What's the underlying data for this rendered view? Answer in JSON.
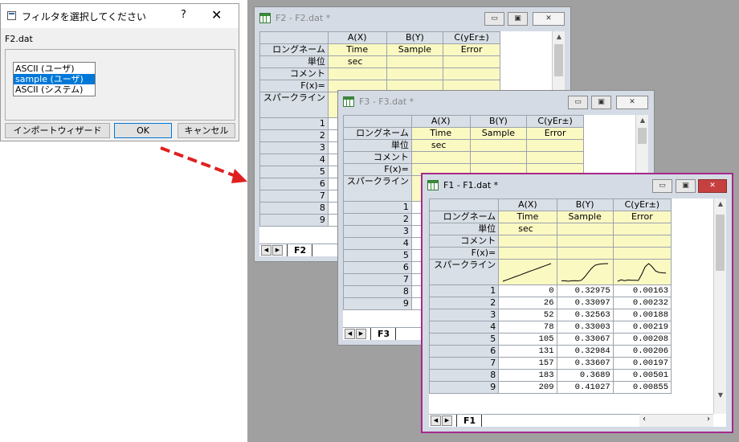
{
  "dialog": {
    "title": "フィルタを選択してください",
    "help_glyph": "?",
    "close_glyph": "✕",
    "filename": "F2.dat",
    "list_items": [
      "ASCII (ユーザ)",
      "sample (ユーザ)",
      "ASCII (システム)"
    ],
    "selected_index": 1,
    "buttons": {
      "wizard": "インポートウィザード",
      "ok": "OK",
      "cancel": "キャンセル"
    }
  },
  "row_labels": {
    "longname": "ロングネーム",
    "units": "単位",
    "comment": "コメント",
    "fx": "F(x)=",
    "sparkline": "スパークライン"
  },
  "columns": [
    "A(X)",
    "B(Y)",
    "C(yEr±)"
  ],
  "long_names": [
    "Time",
    "Sample",
    "Error"
  ],
  "units": [
    "sec",
    "",
    ""
  ],
  "window_buttons": {
    "minimize": "▭",
    "maximize": "▣",
    "close": "✕"
  },
  "windows": {
    "f2": {
      "title": "F2 - F2.dat *",
      "tab": "F2",
      "rows": [
        "1",
        "2",
        "3",
        "4",
        "5",
        "6",
        "7",
        "8",
        "9"
      ]
    },
    "f3": {
      "title": "F3 - F3.dat *",
      "tab": "F3",
      "rows": [
        "1",
        "2",
        "3",
        "4",
        "5",
        "6",
        "7",
        "8",
        "9"
      ]
    },
    "f1": {
      "title": "F1 - F1.dat *",
      "tab": "F1",
      "rows": [
        [
          "1",
          "0",
          "0.32975",
          "0.00163"
        ],
        [
          "2",
          "26",
          "0.33097",
          "0.00232"
        ],
        [
          "3",
          "52",
          "0.32563",
          "0.00188"
        ],
        [
          "4",
          "78",
          "0.33003",
          "0.00219"
        ],
        [
          "5",
          "105",
          "0.33067",
          "0.00208"
        ],
        [
          "6",
          "131",
          "0.32984",
          "0.00206"
        ],
        [
          "7",
          "157",
          "0.33607",
          "0.00197"
        ],
        [
          "8",
          "183",
          "0.3689",
          "0.00501"
        ],
        [
          "9",
          "209",
          "0.41027",
          "0.00855"
        ]
      ]
    }
  },
  "colors": {
    "workspace": "#a0a0a0",
    "label_cell": "#fbf9c2",
    "active_border": "#a52a8a",
    "arrow": "#e02020",
    "selection": "#0078d7"
  }
}
